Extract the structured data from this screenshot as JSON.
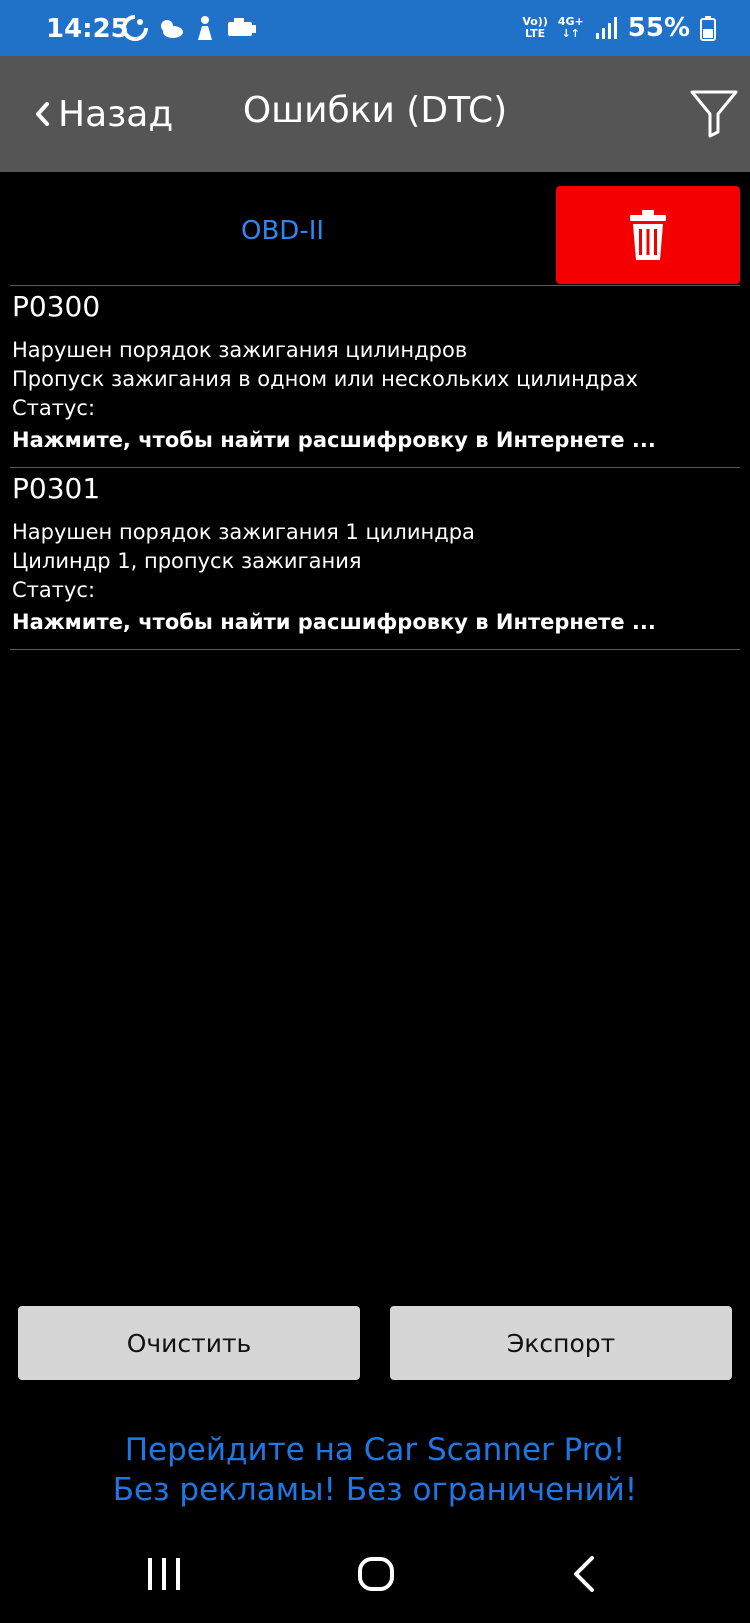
{
  "status_bar": {
    "time": "14:25",
    "net_top": "Vo))",
    "net_bottom": "LTE",
    "gen_top": "4G+",
    "gen_bottom": "↓↑",
    "battery": "55%",
    "icons": [
      "sync-icon",
      "weather-icon",
      "person-icon",
      "car-engine-icon",
      "signal-icon",
      "battery-icon"
    ]
  },
  "header": {
    "back_label": "Назад",
    "title": "Ошибки (DTC)",
    "filter_icon": "filter-icon"
  },
  "section": {
    "label": "OBD-II",
    "delete_icon": "trash-icon",
    "delete_color": "#f50000"
  },
  "dtc_list": [
    {
      "code": "P0300",
      "desc1": "Нарушен порядок зажигания цилиндров",
      "desc2": "Пропуск зажигания в одном или нескольких цилиндрах",
      "status": "Статус:",
      "link": "Нажмите, чтобы найти расшифровку в Интернете ..."
    },
    {
      "code": "P0301",
      "desc1": "Нарушен порядок зажигания 1 цилиндра",
      "desc2": "Цилиндр 1, пропуск зажигания",
      "status": "Статус:",
      "link": "Нажмите, чтобы найти расшифровку в Интернете ..."
    }
  ],
  "actions": {
    "clear_label": "Очистить",
    "export_label": "Экспорт"
  },
  "promo": {
    "line1": "Перейдите на Car Scanner Pro!",
    "line2": "Без рекламы! Без ограничений!"
  },
  "colors": {
    "status_bar": "#1f72c8",
    "nav_bar": "#555555",
    "accent_blue": "#2f86ef",
    "promo_blue": "#1f77e3"
  }
}
